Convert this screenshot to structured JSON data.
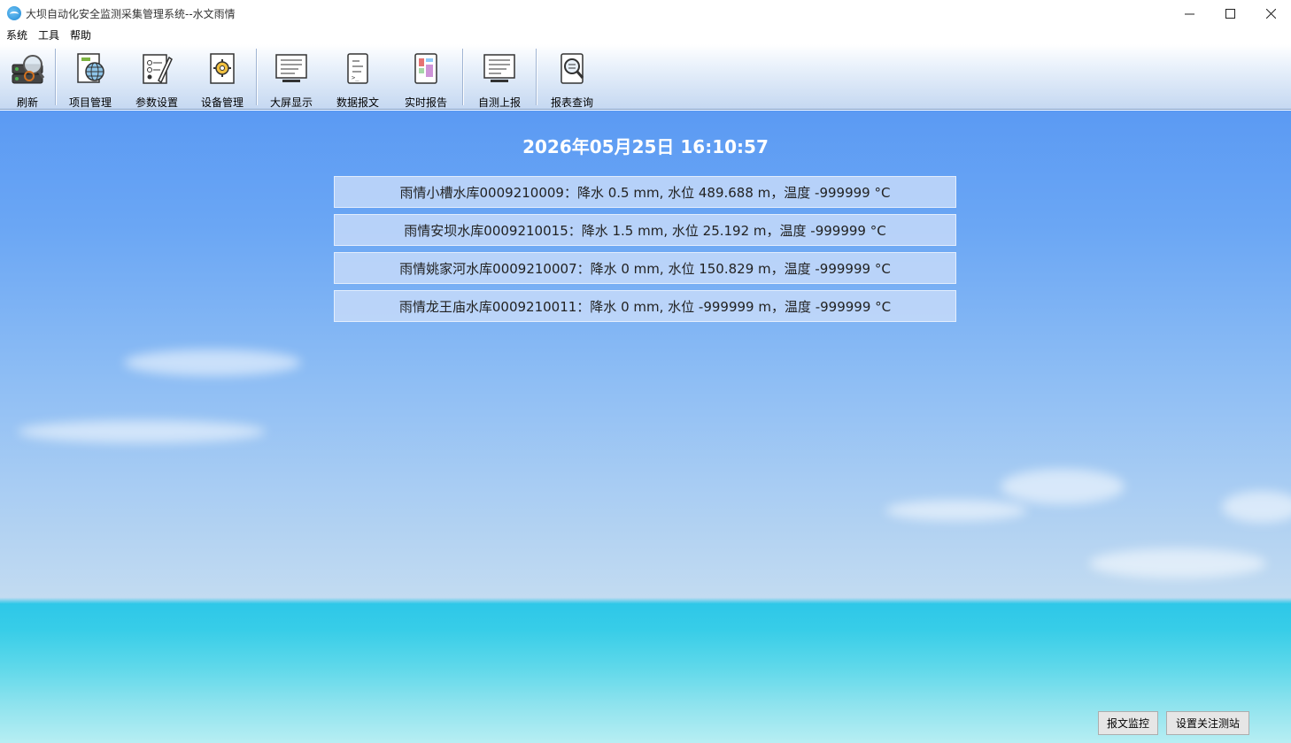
{
  "window": {
    "title": "大坝自动化安全监测采集管理系统--水文雨情",
    "controls": {
      "minimize": "—",
      "maximize": "☐",
      "close": "✕"
    }
  },
  "menu": [
    "系统",
    "工具",
    "帮助"
  ],
  "toolbar": [
    {
      "label": "刷新",
      "icon": "refresh-icon"
    },
    {
      "label": "项目管理",
      "icon": "project-globe-icon"
    },
    {
      "label": "参数设置",
      "icon": "parameter-settings-icon"
    },
    {
      "label": "设备管理",
      "icon": "device-gear-icon"
    },
    {
      "label": "大屏显示",
      "icon": "monitor-icon"
    },
    {
      "label": "数据报文",
      "icon": "data-document-icon"
    },
    {
      "label": "实时报告",
      "icon": "report-icon"
    },
    {
      "label": "自测上报",
      "icon": "upload-monitor-icon"
    },
    {
      "label": "报表查询",
      "icon": "search-report-icon"
    }
  ],
  "datetime": "2026年05月25日 16:10:57",
  "stations": [
    {
      "text": "雨情小槽水库0009210009：降水 0.5 mm, 水位 489.688 m，温度 -999999 °C"
    },
    {
      "text": "雨情安坝水库0009210015：降水 1.5 mm, 水位 25.192 m，温度 -999999 °C"
    },
    {
      "text": "雨情姚家河水库0009210007：降水 0 mm, 水位 150.829 m，温度 -999999 °C"
    },
    {
      "text": "雨情龙王庙水库0009210011：降水 0 mm, 水位 -999999 m，温度 -999999 °C"
    }
  ],
  "buttons": {
    "monitor": "报文监控",
    "set_focus": "设置关注测站"
  }
}
